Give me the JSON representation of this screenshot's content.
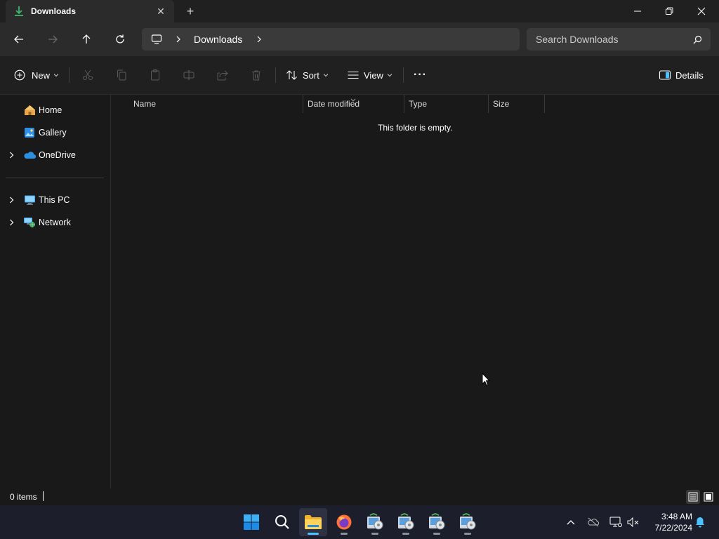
{
  "window": {
    "tab_title": "Downloads",
    "tab_close": "✕",
    "new_tab": "+"
  },
  "nav": {
    "breadcrumb": [
      "Downloads"
    ],
    "search_placeholder": "Search Downloads"
  },
  "commands": {
    "new_label": "New",
    "sort_label": "Sort",
    "view_label": "View",
    "more_label": "···",
    "details_label": "Details"
  },
  "sidebar": {
    "items": [
      {
        "label": "Home",
        "icon": "home-icon",
        "expandable": false
      },
      {
        "label": "Gallery",
        "icon": "gallery-icon",
        "expandable": false
      },
      {
        "label": "OneDrive",
        "icon": "onedrive-icon",
        "expandable": true
      },
      {
        "label": "This PC",
        "icon": "this-pc-icon",
        "expandable": true
      },
      {
        "label": "Network",
        "icon": "network-icon",
        "expandable": true
      }
    ]
  },
  "columns": {
    "name": "Name",
    "date_modified": "Date modified",
    "type": "Type",
    "size": "Size"
  },
  "content": {
    "empty_message": "This folder is empty."
  },
  "status": {
    "item_count": "0 items"
  },
  "taskbar": {
    "apps": [
      "start-icon",
      "search-icon",
      "file-explorer-icon",
      "firefox-icon",
      "installer-icon",
      "installer-icon",
      "installer-icon",
      "installer-icon"
    ],
    "active_app": "file-explorer-icon"
  },
  "clock": {
    "time": "3:48 AM",
    "date": "7/22/2024"
  },
  "colors": {
    "accent": "#4cc2ff",
    "window_bg": "#191919",
    "address_bg": "#3a3a3a",
    "taskbar_bg": "#1c1f2b"
  }
}
